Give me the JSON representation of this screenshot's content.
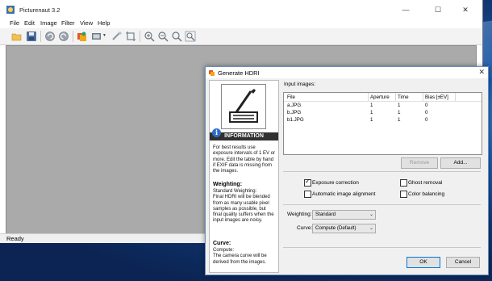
{
  "app": {
    "title": "Picturenaut 3.2",
    "controls": {
      "minimize": "—",
      "maximize": "☐",
      "close": "✕"
    }
  },
  "menu": [
    "File",
    "Edit",
    "Image",
    "Filter",
    "View",
    "Help"
  ],
  "toolbar_icons": [
    "open-icon",
    "save-icon",
    "undo-icon",
    "redo-icon",
    "generate-hdri-icon",
    "tone-map-icon",
    "batch-icon",
    "crop-icon",
    "zoom-in-icon",
    "zoom-out-icon",
    "zoom-fit-icon",
    "zoom-actual-icon"
  ],
  "status": {
    "text": "Ready"
  },
  "dialog": {
    "title": "Generate HDRI",
    "close": "✕",
    "info": {
      "header": "INFORMATION",
      "badge": "i",
      "intro": [
        "For best results use",
        "exposure intervals of 1 EV or",
        "more. Edit the table by hand",
        "if EXIF data is missing from",
        "the images."
      ],
      "weighting_head": "Weighting:",
      "weighting_text": [
        "Standard Weighting:",
        "Final HDRI will be blended",
        "from as many usable pixel",
        "samples as possible, but",
        "final quality suffers when the",
        "input images are noisy."
      ],
      "curve_head": "Curve:",
      "curve_text": [
        "Compute:",
        "The camera curve will be",
        "derived from the images."
      ]
    },
    "input_label": "Input images:",
    "table": {
      "columns": [
        "File",
        "Aperture",
        "Time",
        "Bias [±EV]"
      ],
      "rows": [
        [
          "a.JPG",
          "1",
          "1",
          "0"
        ],
        [
          "b.JPG",
          "1",
          "1",
          "0"
        ],
        [
          "b1.JPG",
          "1",
          "1",
          "0"
        ]
      ]
    },
    "buttons": {
      "remove": "Remove",
      "add": "Add...",
      "ok": "OK",
      "cancel": "Cancel"
    },
    "checks": {
      "exposure": {
        "label": "Exposure correction",
        "checked": true
      },
      "ghost": {
        "label": "Ghost removal",
        "checked": false
      },
      "align": {
        "label": "Automatic image alignment",
        "checked": false
      },
      "color": {
        "label": "Color balancing",
        "checked": false
      }
    },
    "weighting": {
      "label": "Weighting:",
      "value": "Standard"
    },
    "curve": {
      "label": "Curve:",
      "value": "Compute  (Default)"
    }
  }
}
